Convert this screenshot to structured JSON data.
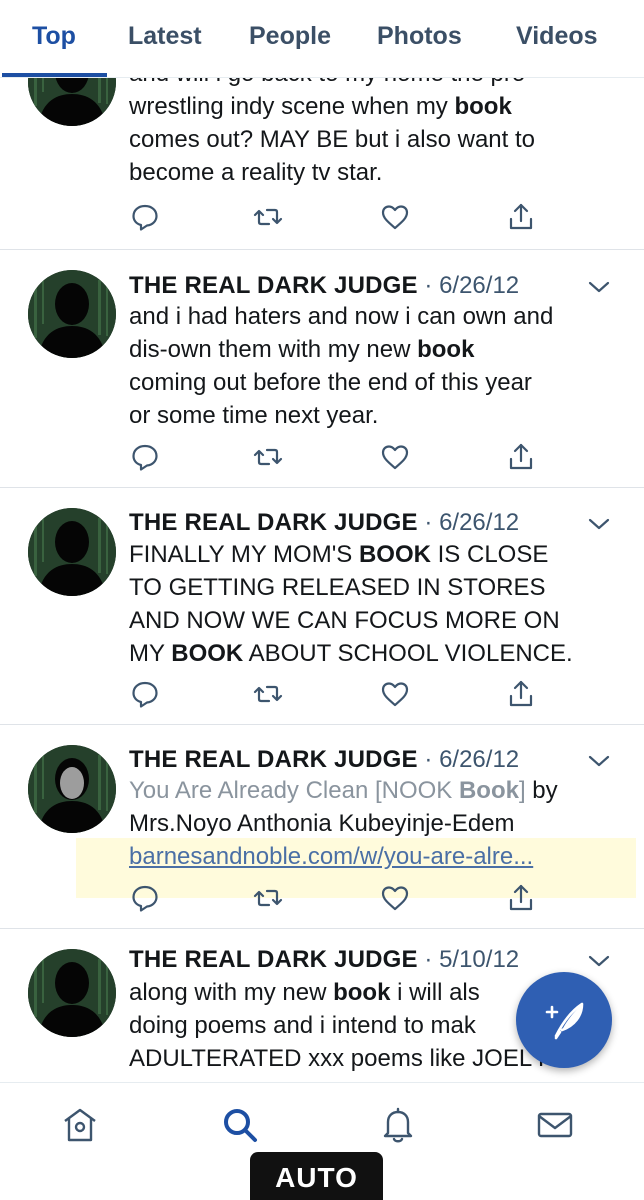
{
  "tabs": [
    {
      "label": "Top",
      "active": true
    },
    {
      "label": "Latest",
      "active": false
    },
    {
      "label": "People",
      "active": false
    },
    {
      "label": "Photos",
      "active": false
    },
    {
      "label": "Videos",
      "active": false
    }
  ],
  "tweets": [
    {
      "lines": [
        "and will i go back to my home the pro",
        "wrestling indy scene when my ",
        "comes out? MAY BE but i also want to",
        "become a reality tv star."
      ],
      "bold_word": "book"
    },
    {
      "name": "THE REAL DARK JUDGE",
      "separator": "·",
      "date": "6/26/12",
      "line1": "and i had haters and now i can own and",
      "line2a": "dis-own them with my new ",
      "line2b": "book",
      "line3": "coming out before the end of this year",
      "line4": "or some time next year."
    },
    {
      "name": "THE REAL DARK JUDGE",
      "separator": "·",
      "date": "6/26/12",
      "line1a": "FINALLY MY MOM'S ",
      "line1b": "BOOK",
      "line1c": " IS CLOSE",
      "line2": "TO GETTING RELEASED IN STORES",
      "line3": "AND NOW WE CAN FOCUS MORE ON",
      "line4a": "MY ",
      "line4b": "BOOK",
      "line4c": " ABOUT SCHOOL VIOLENCE."
    },
    {
      "name": "THE REAL DARK JUDGE",
      "separator": "·",
      "date": "6/26/12",
      "line1a": "You Are Already Clean [NOOK ",
      "line1b": "Book",
      "line1c": "]",
      "line1d": " by",
      "line2": "Mrs.Noyo Anthonia Kubeyinje-Edem",
      "link": "barnesandnoble.com/w/you-are-alre..."
    },
    {
      "name": "THE REAL DARK JUDGE",
      "separator": "·",
      "date": "5/10/12",
      "line1a": "along with my new ",
      "line1b": "book",
      "line1c": " i will als",
      "line2": "doing poems and i intend to mak",
      "line3": "ADULTERATED xxx poems like JOEL HE"
    }
  ],
  "icons": {
    "reply": "reply-icon",
    "retweet": "retweet-icon",
    "like": "heart-icon",
    "share": "share-icon",
    "compose": "compose-feather-icon"
  },
  "bottom_nav": [
    "home-icon",
    "search-icon",
    "notifications-bell-icon",
    "messages-mail-icon"
  ],
  "badge": "AUTO",
  "colors": {
    "accent": "#1d4fa3",
    "fab": "#2f5fb3",
    "icon_gray": "#3d556e"
  }
}
